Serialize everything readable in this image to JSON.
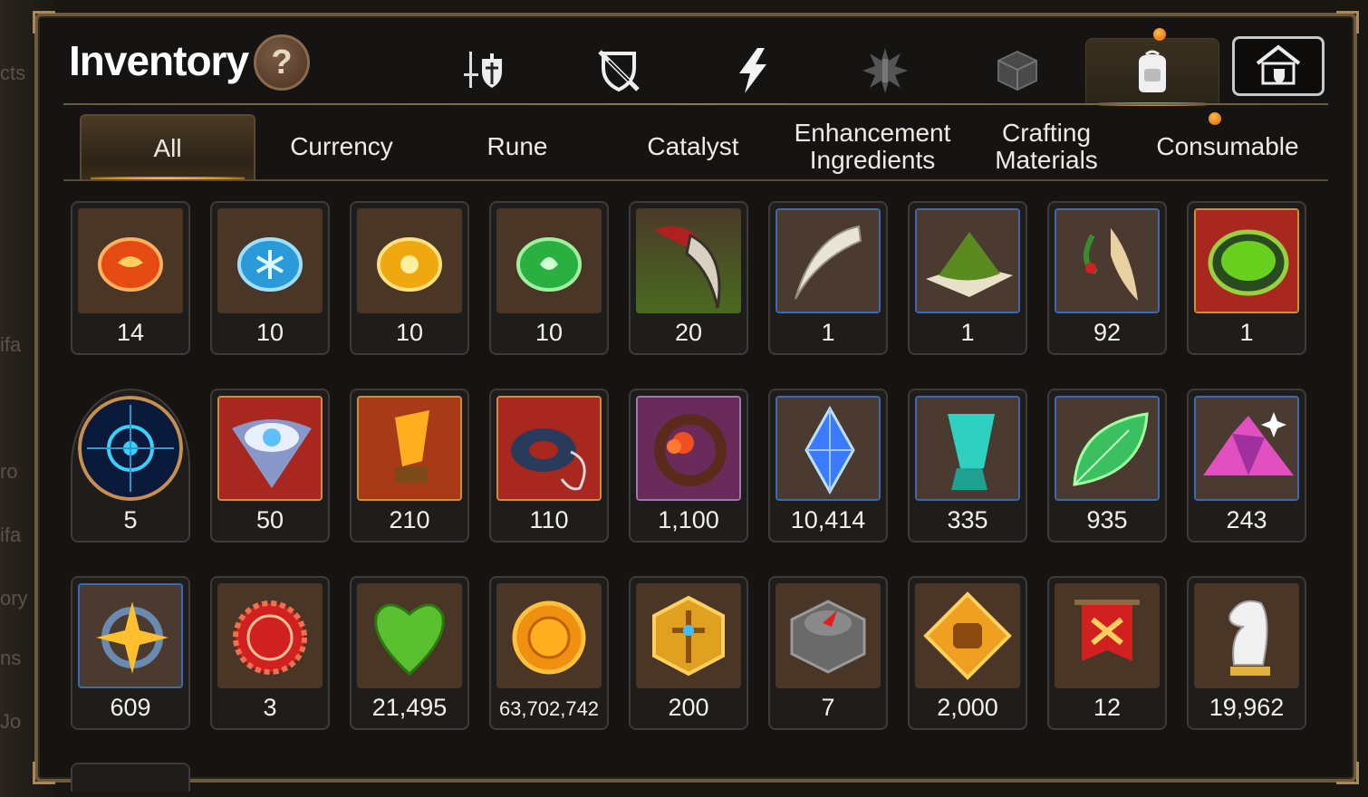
{
  "background_hints": [
    "cts",
    "ifa",
    "ro",
    "ifa",
    "ory",
    "ns",
    "Jo"
  ],
  "header": {
    "title": "Inventory",
    "help_label": "?"
  },
  "category_tabs": [
    {
      "icon": "sword-shield-icon",
      "active": false
    },
    {
      "icon": "crossed-shield-icon",
      "active": false
    },
    {
      "icon": "lightning-icon",
      "active": false
    },
    {
      "icon": "spiky-emblem-icon",
      "active": false
    },
    {
      "icon": "dice-box-icon",
      "active": false
    },
    {
      "icon": "backpack-icon",
      "active": true,
      "notification": true
    },
    {
      "icon": "knight-house-icon",
      "active": false
    }
  ],
  "filters": [
    {
      "label": "All",
      "active": true
    },
    {
      "label": "Currency"
    },
    {
      "label": "Rune"
    },
    {
      "label": "Catalyst"
    },
    {
      "label": "Enhancement Ingredients"
    },
    {
      "label": "Crafting Materials"
    },
    {
      "label": "Consumable",
      "notification": true
    }
  ],
  "items": [
    {
      "icon": "red-rune-icon",
      "count": "14"
    },
    {
      "icon": "blue-rune-icon",
      "count": "10"
    },
    {
      "icon": "yellow-rune-icon",
      "count": "10"
    },
    {
      "icon": "green-rune-icon",
      "count": "10"
    },
    {
      "icon": "claw-icon",
      "count": "20"
    },
    {
      "icon": "fang-icon",
      "count": "1"
    },
    {
      "icon": "moss-pile-icon",
      "count": "1"
    },
    {
      "icon": "root-herb-icon",
      "count": "92"
    },
    {
      "icon": "green-potion-icon",
      "count": "1"
    },
    {
      "icon": "blue-orb-icon",
      "count": "5"
    },
    {
      "icon": "eye-emblem-icon",
      "count": "50"
    },
    {
      "icon": "amber-crystal-icon",
      "count": "210"
    },
    {
      "icon": "stone-ring-icon",
      "count": "110"
    },
    {
      "icon": "flower-ring-icon",
      "count": "1,100"
    },
    {
      "icon": "blue-gem-icon",
      "count": "10,414"
    },
    {
      "icon": "teal-crystal-icon",
      "count": "335"
    },
    {
      "icon": "leaf-icon",
      "count": "935"
    },
    {
      "icon": "pink-mineral-icon",
      "count": "243"
    },
    {
      "icon": "star-amulet-icon",
      "count": "609"
    },
    {
      "icon": "red-seal-icon",
      "count": "3"
    },
    {
      "icon": "green-heart-icon",
      "count": "21,495"
    },
    {
      "icon": "gold-coin-icon",
      "count": "63,702,742"
    },
    {
      "icon": "gold-crest-icon",
      "count": "200"
    },
    {
      "icon": "stone-compass-icon",
      "count": "7"
    },
    {
      "icon": "fist-badge-icon",
      "count": "2,000"
    },
    {
      "icon": "banner-icon",
      "count": "12"
    },
    {
      "icon": "knight-chess-icon",
      "count": "19,962"
    }
  ]
}
